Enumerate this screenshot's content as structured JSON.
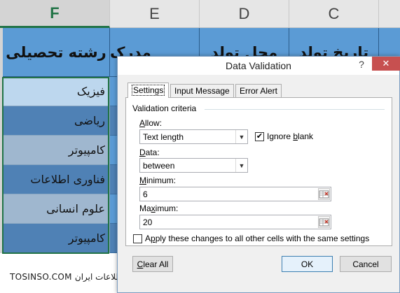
{
  "sheet": {
    "columns": [
      "F",
      "E",
      "D",
      "C"
    ],
    "headers": [
      "رشته تحصیلی",
      "مدرک",
      "محل تولد",
      "تاریخ تولد"
    ],
    "rows": [
      "فیزیک",
      "ریاضی",
      "کامپیوتر",
      "فناوری اطلاعات",
      "علوم انسانی",
      "کامپیوتر"
    ]
  },
  "watermark": "TOSINSO.COM انجمن تخصصی فناوری اطلاعات ایران - ITPro.ir",
  "dialog": {
    "title": "Data Validation",
    "help": "?",
    "close": "✕",
    "tabs": [
      "Settings",
      "Input Message",
      "Error Alert"
    ],
    "group_title": "Validation criteria",
    "allow": {
      "label_pre": "",
      "label_u": "A",
      "label_post": "llow:",
      "value": "Text length"
    },
    "ignore_blank": {
      "label_pre": "Ignore ",
      "label_u": "b",
      "label_post": "lank",
      "checked": true
    },
    "data": {
      "label_pre": "",
      "label_u": "D",
      "label_post": "ata:",
      "value": "between"
    },
    "minimum": {
      "label_pre": "",
      "label_u": "M",
      "label_post": "inimum:",
      "value": "6"
    },
    "maximum": {
      "label_pre": "Ma",
      "label_u": "x",
      "label_post": "imum:",
      "value": "20"
    },
    "apply_all": {
      "label_pre": "A",
      "label_u": "p",
      "label_post": "ply these changes to all other cells with the same settings",
      "checked": false
    },
    "buttons": {
      "clear_pre": "",
      "clear_u": "C",
      "clear_post": "lear All",
      "ok": "OK",
      "cancel": "Cancel"
    }
  }
}
